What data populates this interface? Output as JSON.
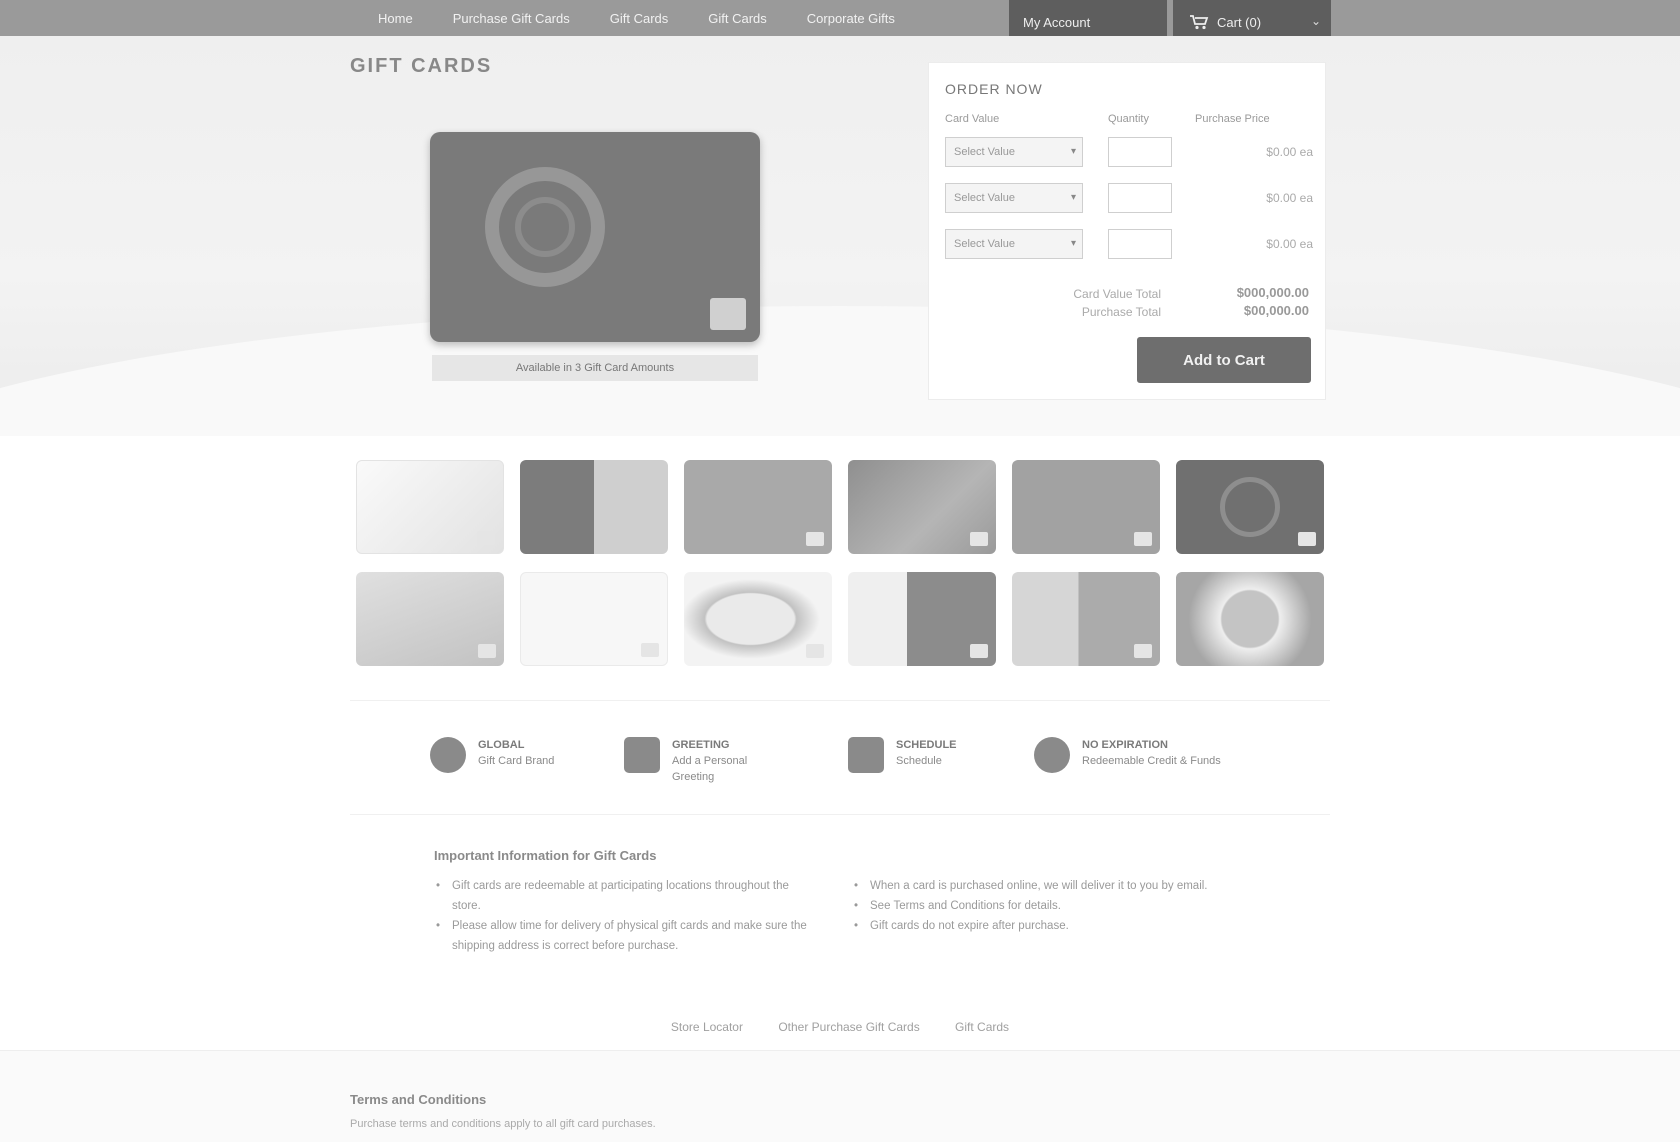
{
  "nav": {
    "links": [
      "Home",
      "Purchase Gift Cards",
      "Gift Cards",
      "Gift Cards",
      "Corporate Gifts"
    ],
    "account_label": "My Account",
    "cart_label": "Cart (0)"
  },
  "page": {
    "title": "GIFT CARDS"
  },
  "hero": {
    "caption": "Available in 3 Gift Card Amounts"
  },
  "order": {
    "title": "ORDER NOW",
    "headers": {
      "card_value": "Card Value",
      "quantity": "Quantity",
      "purchase_price": "Purchase Price"
    },
    "rows": [
      {
        "select": "Select Value",
        "price": "$0.00 ea"
      },
      {
        "select": "Select Value",
        "price": "$0.00 ea"
      },
      {
        "select": "Select Value",
        "price": "$0.00 ea"
      }
    ],
    "totals": {
      "card_value_label": "Card Value Total",
      "card_value_amount": "$000,000.00",
      "purchase_label": "Purchase Total",
      "purchase_amount": "$00,000.00"
    },
    "add_button": "Add to Cart"
  },
  "thumbnails": {
    "count": 12
  },
  "features": [
    {
      "title": "GLOBAL",
      "sub": "Gift Card Brand"
    },
    {
      "title": "GREETING",
      "sub": "Add a Personal Greeting"
    },
    {
      "title": "SCHEDULE",
      "sub": "Schedule"
    },
    {
      "title": "NO EXPIRATION",
      "sub": "Redeemable Credit & Funds"
    }
  ],
  "info": {
    "title": "Important Information for Gift Cards",
    "left": [
      "Gift cards are redeemable at participating locations throughout the store.",
      "Please allow time for delivery of physical gift cards and make sure the shipping address is correct before purchase."
    ],
    "right": [
      "When a card is purchased online, we will deliver it to you by email.",
      "See Terms and Conditions for details.",
      "Gift cards do not expire after purchase."
    ]
  },
  "footer": {
    "links": [
      "Store Locator",
      "Other Purchase Gift Cards",
      "Gift Cards"
    ],
    "terms_title": "Terms and Conditions",
    "terms_text": "Purchase terms and conditions apply to all gift card purchases."
  }
}
